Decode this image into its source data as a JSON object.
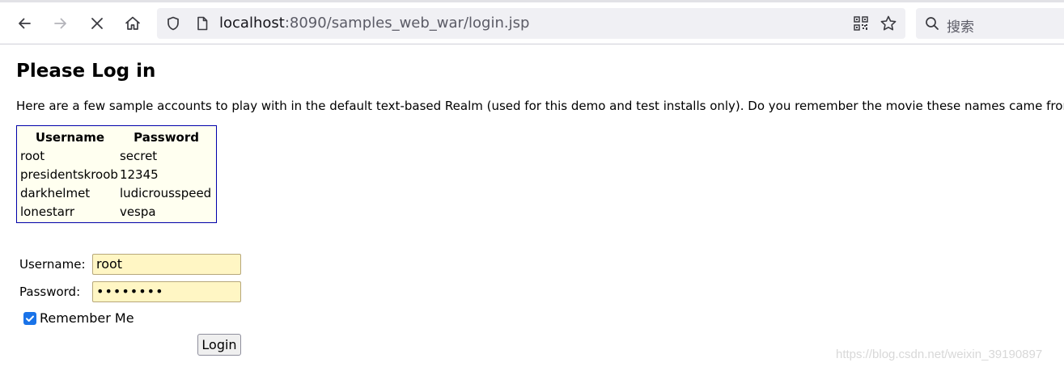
{
  "browser": {
    "url_host": "localhost",
    "url_rest": ":8090/samples_web_war/login.jsp",
    "search_placeholder": "搜索",
    "icons": [
      "back-arrow-icon",
      "forward-arrow-icon",
      "stop-icon",
      "home-icon",
      "shield-icon",
      "page-icon",
      "qr-code-icon",
      "star-icon",
      "search-icon"
    ]
  },
  "page": {
    "title": "Please Log in",
    "intro": "Here are a few sample accounts to play with in the default text-based Realm (used for this demo and test installs only). Do you remember the movie these names came from?",
    "accounts_table": {
      "headers": [
        "Username",
        "Password"
      ],
      "rows": [
        [
          "root",
          "secret"
        ],
        [
          "presidentskroob",
          "12345"
        ],
        [
          "darkhelmet",
          "ludicrousspeed"
        ],
        [
          "lonestarr",
          "vespa"
        ]
      ]
    },
    "form": {
      "username_label": "Username:",
      "username_value": "root",
      "password_label": "Password:",
      "password_value": "••••••••",
      "remember_label": "Remember Me",
      "remember_checked": true,
      "submit_label": "Login"
    },
    "watermark": "https://blog.csdn.net/weixin_39190897"
  },
  "colors": {
    "table_border": "#0000aa",
    "table_background": "#fffff0",
    "input_background": "#fff6c4",
    "checkbox_accent": "#1a73e8"
  }
}
